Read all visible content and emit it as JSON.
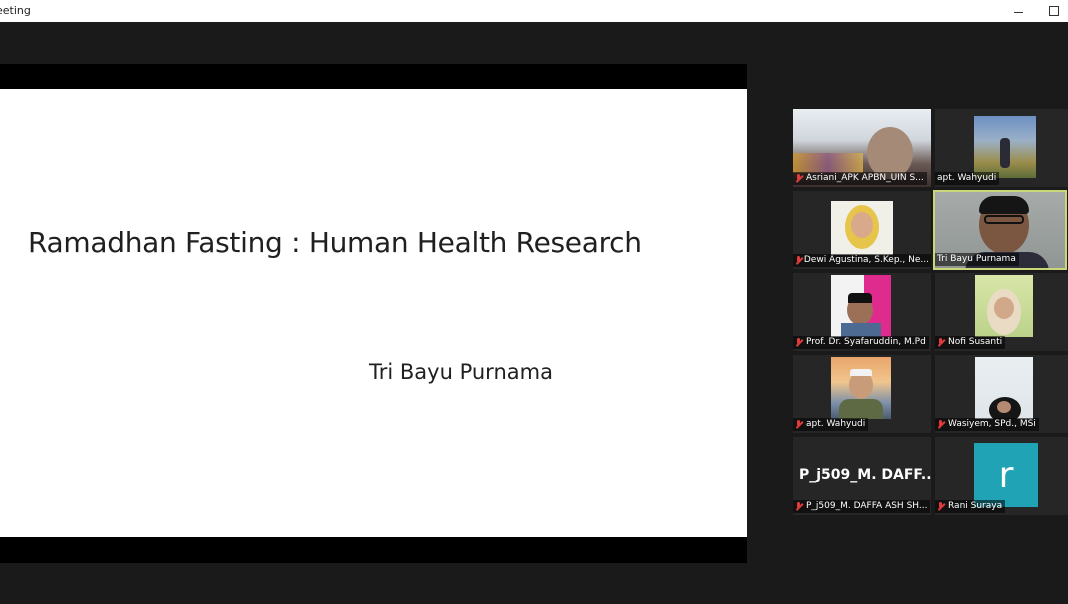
{
  "window": {
    "title": "eeting",
    "minimize_label": "–",
    "maximize_label": "□"
  },
  "slide": {
    "title": "Ramadhan Fasting : Human Health Research",
    "author": "Tri Bayu Purnama"
  },
  "participants": [
    {
      "name": "Asriani_APK APBN_UIN S...",
      "muted": true
    },
    {
      "name": "apt. Wahyudi",
      "muted": false
    },
    {
      "name": "Dewi Agustina, S.Kep., Ne...",
      "muted": true
    },
    {
      "name": "Tri Bayu Purnama",
      "muted": false,
      "active": true
    },
    {
      "name": "Prof. Dr. Syafaruddin, M.Pd",
      "muted": true
    },
    {
      "name": "Nofi Susanti",
      "muted": true
    },
    {
      "name": "apt. Wahyudi",
      "muted": true
    },
    {
      "name": "Wasiyem, SPd., MSi",
      "muted": true
    },
    {
      "name": "P_j509_M. DAFFA ASH SH...",
      "muted": true,
      "display_text": "P_j509_M. DAFF..."
    },
    {
      "name": "Rani Suraya",
      "muted": true,
      "avatar_letter": "r"
    }
  ],
  "colors": {
    "active_border": "#c9d67a",
    "avatar_teal": "#1fa3b5",
    "muted_red": "#e23b3b"
  }
}
